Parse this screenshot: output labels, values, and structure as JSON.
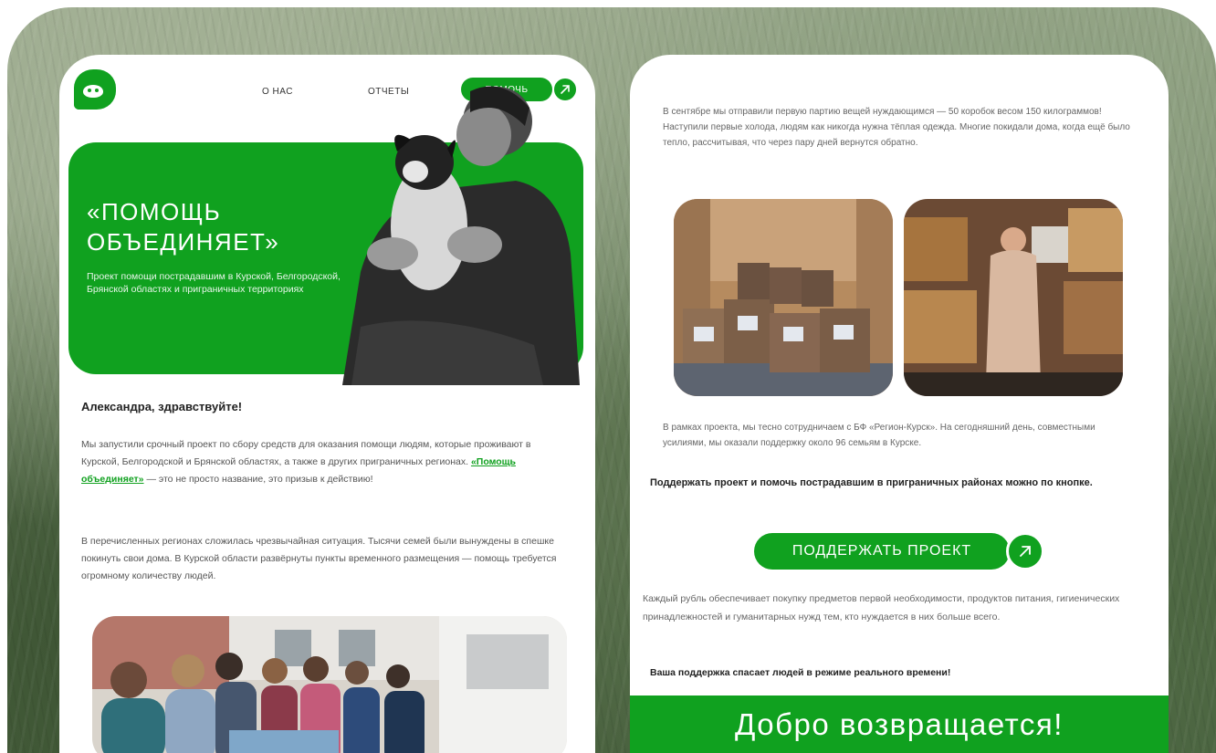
{
  "nav": {
    "about": "О НАС",
    "reports": "ОТЧЕТЫ",
    "help": "ПОМОЧЬ"
  },
  "hero": {
    "title": "«ПОМОЩЬ ОБЪЕДИНЯЕТ»",
    "subtitle": "Проект помощи пострадавшим в Курской, Белгородской, Брянской областях и приграничных территориях"
  },
  "letter": {
    "greeting": "Александра, здравствуйте!",
    "p1_before": "Мы запустили срочный проект по сбору средств для оказания помощи людям, которые проживают в Курской, Белгородской и Брянской областях, а также в других приграничных регионах. ",
    "p1_link": "«Помощь объединяет»",
    "p1_after": " — это не просто название, это призыв к действию!",
    "p2": "В перечисленных регионах сложилась чрезвычайная ситуация. Тысячи семей были вынуждены в спешке покинуть свои дома. В Курской области развёрнуты пункты временного размещения — помощь требуется огромному количеству людей."
  },
  "right": {
    "p1": "В сентябре мы отправили первую партию вещей нуждающимся — 50 коробок весом 150 килограммов! Наступили первые холода, людям как никогда нужна тёплая одежда. Многие покидали дома, когда ещё было тепло, рассчитывая, что через пару дней вернутся обратно.",
    "p2": "В рамках проекта, мы тесно сотрудничаем с БФ «Регион-Курск». На сегодняшний день, совместными усилиями, мы оказали поддержку около 96 семьям в Курске.",
    "cta_text": "Поддержать проект и помочь пострадавшим в приграничных районах можно по кнопке.",
    "button": "ПОДДЕРЖАТЬ ПРОЕКТ",
    "p3": "Каждый рубль обеспечивает покупку предметов первой необходимости, продуктов питания, гигиенических принадлежностей и гуманитарных нужд тем, кто нуждается в них больше всего.",
    "closing": "Ваша поддержка спасает людей в режиме реального времени!",
    "banner": "Добро возвращается!"
  },
  "colors": {
    "brand": "#10a11f",
    "text": "#555555"
  },
  "icons": {
    "arrow": "arrow-up-right-icon",
    "logo": "heart-face-logo"
  }
}
